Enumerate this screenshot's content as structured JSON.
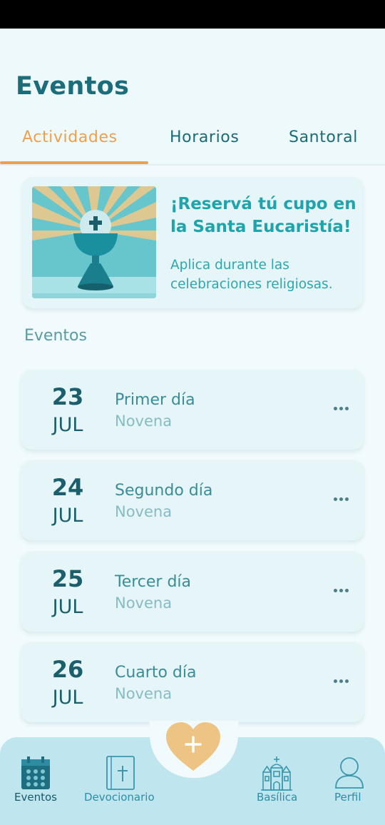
{
  "header": {
    "title": "Eventos"
  },
  "tabs": [
    {
      "label": "Actividades",
      "active": true
    },
    {
      "label": "Horarios",
      "active": false
    },
    {
      "label": "Santoral",
      "active": false
    }
  ],
  "promo": {
    "title": "¡Reservá tú cupo en la Santa Eucaristía!",
    "description": "Aplica durante las celebraciones religiosas.",
    "image": "chalice-illustration"
  },
  "section_title": "Eventos",
  "events": [
    {
      "day": "23",
      "month": "JUL",
      "title": "Primer día",
      "subtitle": "Novena"
    },
    {
      "day": "24",
      "month": "JUL",
      "title": "Segundo día",
      "subtitle": "Novena"
    },
    {
      "day": "25",
      "month": "JUL",
      "title": "Tercer día",
      "subtitle": "Novena"
    },
    {
      "day": "26",
      "month": "JUL",
      "title": "Cuarto día",
      "subtitle": "Novena"
    }
  ],
  "bottom_nav": {
    "items": [
      {
        "label": "Eventos",
        "icon": "calendar-icon",
        "active": true
      },
      {
        "label": "Devocionario",
        "icon": "bible-icon",
        "active": false
      },
      {
        "label": "Basílica",
        "icon": "church-icon",
        "active": false
      },
      {
        "label": "Perfil",
        "icon": "user-icon",
        "active": false
      }
    ],
    "fab_icon": "heart-plus-icon"
  },
  "colors": {
    "accent": "#f0a04b",
    "primary": "#1b6d7a",
    "teal": "#1fa4ad",
    "card_bg": "#e6f5f8",
    "nav_bg": "#bfe6ee"
  }
}
